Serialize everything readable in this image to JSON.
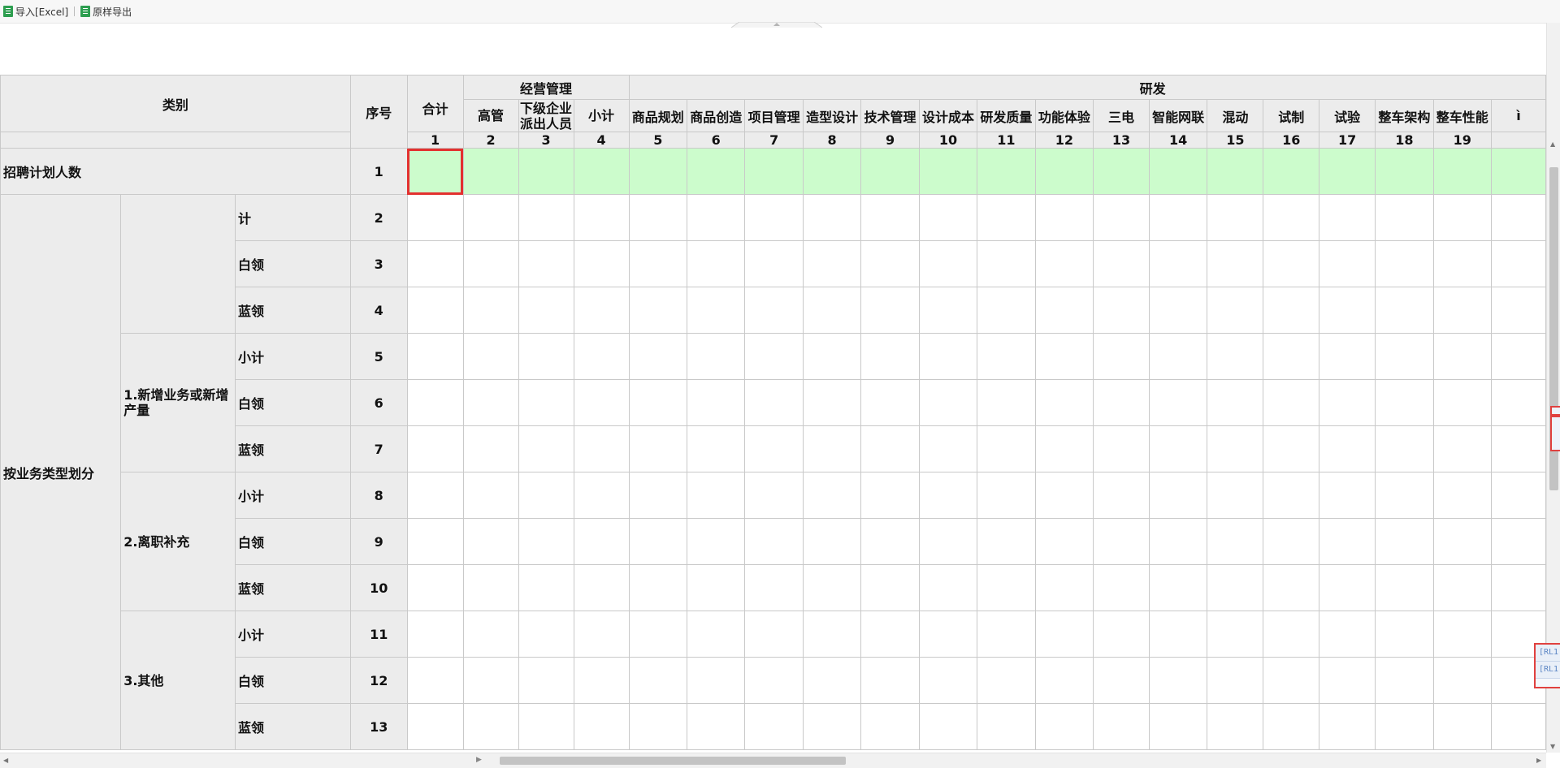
{
  "toolbar": {
    "import_label": "导入[Excel]",
    "export_label": "原样导出"
  },
  "header": {
    "category": "类别",
    "seq": "序号",
    "total": "合计",
    "group_mgmt": "经营管理",
    "group_rd": "研发",
    "mgmt_cols": [
      "高管",
      "下级企业派出人员",
      "小计"
    ],
    "rd_cols": [
      "商品规划",
      "商品创造",
      "项目管理",
      "造型设计",
      "技术管理",
      "设计成本",
      "研发质量",
      "功能体验",
      "三电",
      "智能网联",
      "混动",
      "试制",
      "试验",
      "整车架构",
      "整车性能",
      "ì"
    ],
    "col_numbers": [
      "1",
      "2",
      "3",
      "4",
      "5",
      "6",
      "7",
      "8",
      "9",
      "10",
      "11",
      "12",
      "13",
      "14",
      "15",
      "16",
      "17",
      "18",
      "19"
    ]
  },
  "rows": {
    "plan_label": "招聘计划人数",
    "plan_seq": "1",
    "by_type_label": "按业务类型划分",
    "groups": [
      {
        "name": "",
        "items": [
          {
            "label": "计",
            "seq": "2"
          },
          {
            "label": "白领",
            "seq": "3"
          },
          {
            "label": "蓝领",
            "seq": "4"
          }
        ]
      },
      {
        "name": "1.新增业务或新增产量",
        "items": [
          {
            "label": "小计",
            "seq": "5"
          },
          {
            "label": "白领",
            "seq": "6"
          },
          {
            "label": "蓝领",
            "seq": "7"
          }
        ]
      },
      {
        "name": "2.离职补充",
        "items": [
          {
            "label": "小计",
            "seq": "8"
          },
          {
            "label": "白领",
            "seq": "9"
          },
          {
            "label": "蓝领",
            "seq": "10"
          }
        ]
      },
      {
        "name": "3.其他",
        "items": [
          {
            "label": "小计",
            "seq": "11"
          },
          {
            "label": "白领",
            "seq": "12"
          },
          {
            "label": "蓝领",
            "seq": "13"
          }
        ]
      }
    ]
  },
  "side_widget_rows": [
    "[RL1",
    "[RL1"
  ],
  "colors": {
    "header_bg": "#ececec",
    "plan_row_bg": "#ccfccc",
    "selection": "#e3302f",
    "grid_line": "#c9c9c9"
  }
}
